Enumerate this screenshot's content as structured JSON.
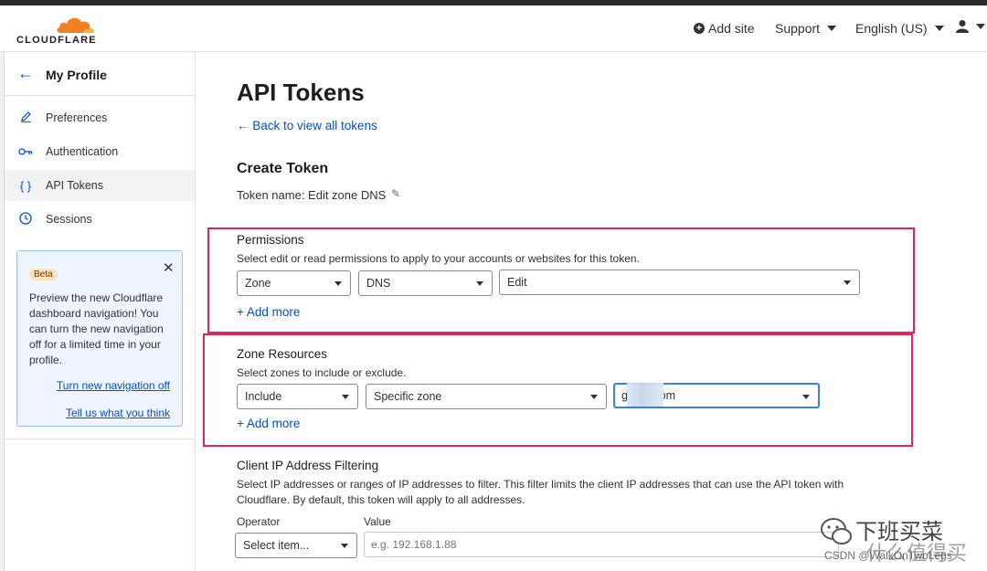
{
  "header": {
    "logo_text": "CLOUDFLARE",
    "add_site": "Add site",
    "support": "Support",
    "language": "English (US)"
  },
  "sidebar": {
    "title": "My Profile",
    "items": [
      {
        "label": "Preferences",
        "icon": "pencil-icon"
      },
      {
        "label": "Authentication",
        "icon": "key-icon"
      },
      {
        "label": "API Tokens",
        "icon": "braces-icon",
        "active": true
      },
      {
        "label": "Sessions",
        "icon": "clock-icon"
      }
    ],
    "beta": {
      "badge": "Beta",
      "text": "Preview the new Cloudflare dashboard navigation! You can turn the new navigation off for a limited time in your profile.",
      "link_off": "Turn new navigation off",
      "link_feedback": "Tell us what you think"
    }
  },
  "main": {
    "title": "API Tokens",
    "back_link": "Back to view all tokens",
    "create_title": "Create Token",
    "token_name": "Token name: Edit zone DNS",
    "permissions": {
      "title": "Permissions",
      "desc": "Select edit or read permissions to apply to your accounts or websites for this token.",
      "select1": "Zone",
      "select2": "DNS",
      "select3": "Edit",
      "add_more": "Add more"
    },
    "zone_resources": {
      "title": "Zone Resources",
      "desc": "Select zones to include or exclude.",
      "select1": "Include",
      "select2": "Specific zone",
      "select3": "g          om",
      "add_more": "Add more"
    },
    "ip_filtering": {
      "title": "Client IP Address Filtering",
      "desc_line1": "Select IP addresses or ranges of IP addresses to filter. This filter limits the client IP addresses that can use the API token with",
      "desc_line2": "Cloudflare. By default, this token will apply to all addresses.",
      "operator_label": "Operator",
      "operator_value": "Select item...",
      "value_label": "Value",
      "value_placeholder": "e.g. 192.168.1.88"
    }
  },
  "watermark": {
    "line1": "下班买菜",
    "line2": "什么值得买",
    "sub": "CSDN @WalkOnTwoLegs"
  },
  "colors": {
    "accent": "#0051c3",
    "brand_orange": "#f38020",
    "highlight_red": "#e0245e"
  }
}
